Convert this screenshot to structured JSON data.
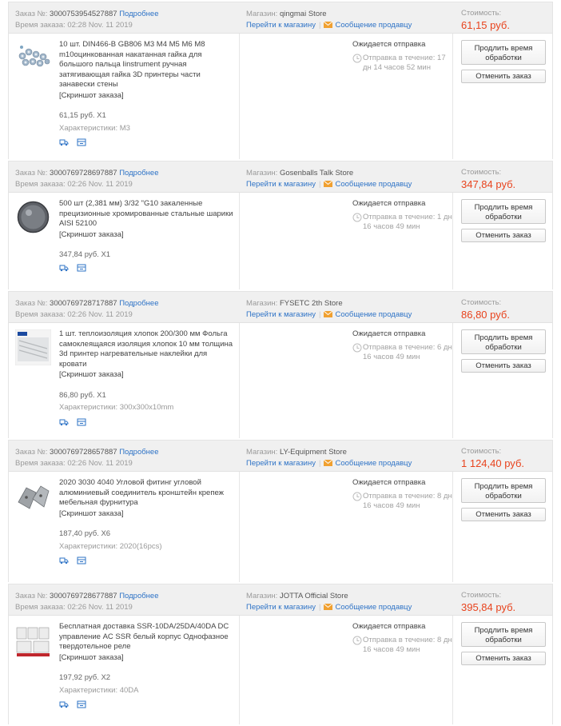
{
  "labels": {
    "order_no": "Заказ №:",
    "details": "Подробнее",
    "order_time": "Время заказа:",
    "store": "Магазин:",
    "goto_store": "Перейти к магазину",
    "msg_seller": "Сообщение продавцу",
    "cost": "Стоимость:",
    "awaiting": "Ожидается отправка",
    "ship_within": "Отправка в течение:",
    "screenshot": "[Скриншот заказа]",
    "extend": "Продлить время обработки",
    "cancel": "Отменить заказ",
    "chars": "Характеристики:"
  },
  "colors": {
    "link": "#2e73c6",
    "price": "#e8431d",
    "header_bg": "#f0f0f0"
  },
  "orders": [
    {
      "number": "3000753954527887",
      "time": "02:28 Nov. 11 2019",
      "store": "qingmai Store",
      "cost": "61,15 руб.",
      "product": "10 шт. DIN466-B GB806 M3 M4 M5 M6 M8 m10оцинкованная накатанная гайка для большого пальца Iinstrument ручная затягивающая гайка 3D принтеры части занавески стены",
      "qty_price": "61,15 руб. X1",
      "spec": "M3",
      "ship_time": "17 дн 14 часов 52 мин",
      "thumb": "nuts"
    },
    {
      "number": "3000769728697887",
      "time": "02:26 Nov. 11 2019",
      "store": "Gosenballs Talk Store",
      "cost": "347,84 руб.",
      "product": "500 шт (2,381 мм) 3/32 \"G10 закаленные прецизионные хромированные стальные шарики AISI 52100",
      "qty_price": "347,84 руб. X1",
      "spec": "",
      "ship_time": "1 дн 16 часов 49 мин",
      "thumb": "balls"
    },
    {
      "number": "3000769728717887",
      "time": "02:26 Nov. 11 2019",
      "store": "FYSETC 2th Store",
      "cost": "86,80 руб.",
      "product": "1 шт. теплоизоляция хлопок 200/300 мм Фольга самоклеящаяся изоляция хлопок 10 мм толщина 3d принтер нагревательные наклейки для кровати",
      "qty_price": "86,80 руб. X1",
      "spec": "300x300x10mm",
      "ship_time": "6 дн 16 часов 49 мин",
      "thumb": "foil"
    },
    {
      "number": "3000769728657887",
      "time": "02:26 Nov. 11 2019",
      "store": "LY-Equipment Store",
      "cost": "1 124,40 руб.",
      "product": "2020 3030 4040 Угловой фитинг угловой алюминиевый соединитель кронштейн крепеж мебельная фурнитура",
      "qty_price": "187,40 руб. X6",
      "spec": "2020(16pcs)",
      "ship_time": "8 дн 16 часов 49 мин",
      "thumb": "bracket"
    },
    {
      "number": "3000769728677887",
      "time": "02:26 Nov. 11 2019",
      "store": "JOTTA Official Store",
      "cost": "395,84 руб.",
      "product": "Бесплатная доставка SSR-10DA/25DA/40DA DC управление AC SSR белый корпус Однофазное твердотельное реле",
      "qty_price": "197,92 руб. X2",
      "spec": "40DA",
      "ship_time": "8 дн 16 часов 49 мин",
      "thumb": "relay"
    }
  ]
}
